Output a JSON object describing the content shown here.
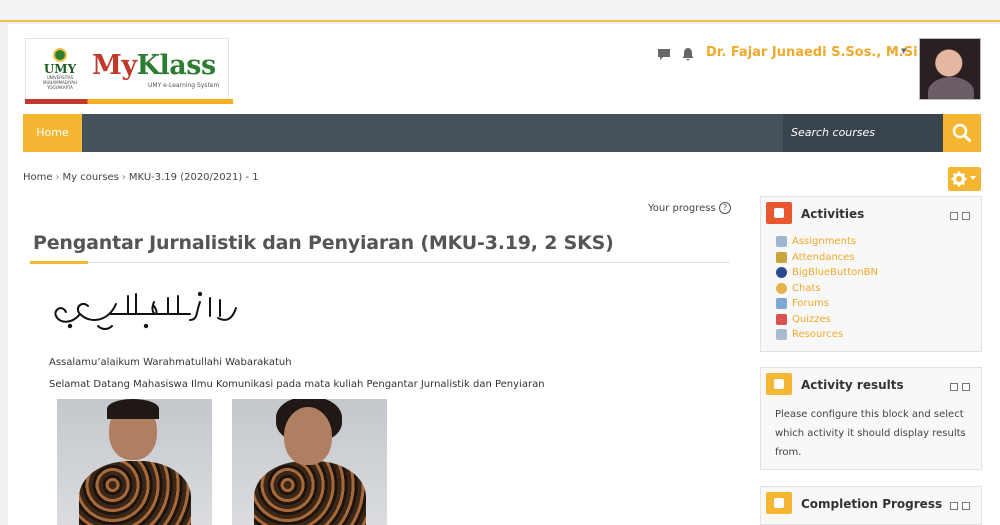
{
  "header": {
    "logo_left_text": "UMY",
    "logo_left_sub": "UNIVERSITAS MUHAMMADIYAH YOGYAKARTA",
    "logo_title_part1": "My",
    "logo_title_part2": "Klass",
    "logo_subtitle": "UMY e-Learning System",
    "user_name": "Dr. Fajar Junaedi S.Sos., M.Si."
  },
  "nav": {
    "home_label": "Home",
    "search_placeholder": "Search courses"
  },
  "breadcrumb": [
    "Home",
    "My courses",
    "MKU-3.19 (2020/2021) - 1"
  ],
  "main": {
    "progress_label": "Your progress",
    "course_title": "Pengantar Jurnalistik dan Penyiaran (MKU-3.19, 2 SKS)",
    "greeting": "Assalamu’alaikum Warahmatullahi Wabarakatuh",
    "welcome": "Selamat Datang Mahasiswa Ilmu Komunikasi pada mata kuliah Pengantar Jurnalistik dan Penyiaran"
  },
  "blocks": {
    "activities": {
      "title": "Activities",
      "items": [
        {
          "label": "Assignments",
          "icon": "assignment-icon"
        },
        {
          "label": "Attendances",
          "icon": "attendance-icon"
        },
        {
          "label": "BigBlueButtonBN",
          "icon": "bigbluebutton-icon"
        },
        {
          "label": "Chats",
          "icon": "chat-icon"
        },
        {
          "label": "Forums",
          "icon": "forum-icon"
        },
        {
          "label": "Quizzes",
          "icon": "quiz-icon"
        },
        {
          "label": "Resources",
          "icon": "resource-icon"
        }
      ]
    },
    "activity_results": {
      "title": "Activity results",
      "text": "Please configure this block and select which activity it should display results from."
    },
    "completion_progress": {
      "title": "Completion Progress"
    }
  },
  "colors": {
    "accent": "#f5b731",
    "navbar": "#46525b",
    "link": "#f0a92b"
  }
}
